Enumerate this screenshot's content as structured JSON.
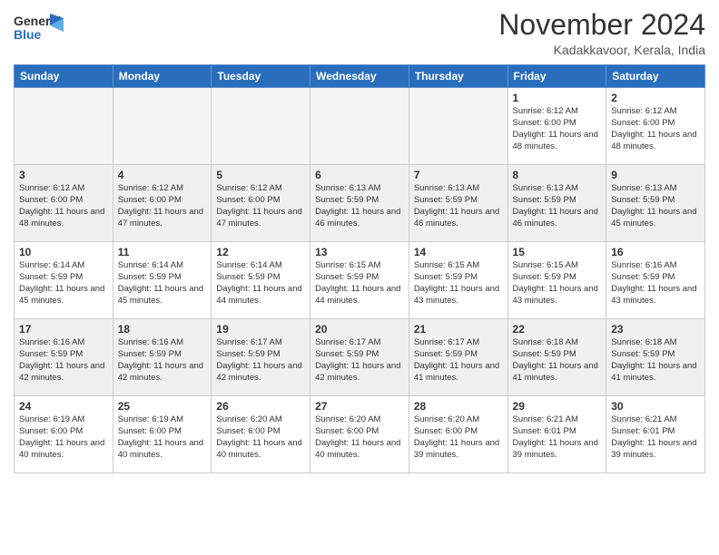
{
  "header": {
    "logo_general": "General",
    "logo_blue": "Blue",
    "month": "November 2024",
    "location": "Kadakkavoor, Kerala, India"
  },
  "days_of_week": [
    "Sunday",
    "Monday",
    "Tuesday",
    "Wednesday",
    "Thursday",
    "Friday",
    "Saturday"
  ],
  "weeks": [
    [
      {
        "day": "",
        "empty": true
      },
      {
        "day": "",
        "empty": true
      },
      {
        "day": "",
        "empty": true
      },
      {
        "day": "",
        "empty": true
      },
      {
        "day": "",
        "empty": true
      },
      {
        "day": "1",
        "sunrise": "6:12 AM",
        "sunset": "6:00 PM",
        "daylight": "11 hours and 48 minutes."
      },
      {
        "day": "2",
        "sunrise": "6:12 AM",
        "sunset": "6:00 PM",
        "daylight": "11 hours and 48 minutes."
      }
    ],
    [
      {
        "day": "3",
        "sunrise": "6:12 AM",
        "sunset": "6:00 PM",
        "daylight": "11 hours and 48 minutes."
      },
      {
        "day": "4",
        "sunrise": "6:12 AM",
        "sunset": "6:00 PM",
        "daylight": "11 hours and 47 minutes."
      },
      {
        "day": "5",
        "sunrise": "6:12 AM",
        "sunset": "6:00 PM",
        "daylight": "11 hours and 47 minutes."
      },
      {
        "day": "6",
        "sunrise": "6:13 AM",
        "sunset": "5:59 PM",
        "daylight": "11 hours and 46 minutes."
      },
      {
        "day": "7",
        "sunrise": "6:13 AM",
        "sunset": "5:59 PM",
        "daylight": "11 hours and 46 minutes."
      },
      {
        "day": "8",
        "sunrise": "6:13 AM",
        "sunset": "5:59 PM",
        "daylight": "11 hours and 46 minutes."
      },
      {
        "day": "9",
        "sunrise": "6:13 AM",
        "sunset": "5:59 PM",
        "daylight": "11 hours and 45 minutes."
      }
    ],
    [
      {
        "day": "10",
        "sunrise": "6:14 AM",
        "sunset": "5:59 PM",
        "daylight": "11 hours and 45 minutes."
      },
      {
        "day": "11",
        "sunrise": "6:14 AM",
        "sunset": "5:59 PM",
        "daylight": "11 hours and 45 minutes."
      },
      {
        "day": "12",
        "sunrise": "6:14 AM",
        "sunset": "5:59 PM",
        "daylight": "11 hours and 44 minutes."
      },
      {
        "day": "13",
        "sunrise": "6:15 AM",
        "sunset": "5:59 PM",
        "daylight": "11 hours and 44 minutes."
      },
      {
        "day": "14",
        "sunrise": "6:15 AM",
        "sunset": "5:59 PM",
        "daylight": "11 hours and 43 minutes."
      },
      {
        "day": "15",
        "sunrise": "6:15 AM",
        "sunset": "5:59 PM",
        "daylight": "11 hours and 43 minutes."
      },
      {
        "day": "16",
        "sunrise": "6:16 AM",
        "sunset": "5:59 PM",
        "daylight": "11 hours and 43 minutes."
      }
    ],
    [
      {
        "day": "17",
        "sunrise": "6:16 AM",
        "sunset": "5:59 PM",
        "daylight": "11 hours and 42 minutes."
      },
      {
        "day": "18",
        "sunrise": "6:16 AM",
        "sunset": "5:59 PM",
        "daylight": "11 hours and 42 minutes."
      },
      {
        "day": "19",
        "sunrise": "6:17 AM",
        "sunset": "5:59 PM",
        "daylight": "11 hours and 42 minutes."
      },
      {
        "day": "20",
        "sunrise": "6:17 AM",
        "sunset": "5:59 PM",
        "daylight": "11 hours and 42 minutes."
      },
      {
        "day": "21",
        "sunrise": "6:17 AM",
        "sunset": "5:59 PM",
        "daylight": "11 hours and 41 minutes."
      },
      {
        "day": "22",
        "sunrise": "6:18 AM",
        "sunset": "5:59 PM",
        "daylight": "11 hours and 41 minutes."
      },
      {
        "day": "23",
        "sunrise": "6:18 AM",
        "sunset": "5:59 PM",
        "daylight": "11 hours and 41 minutes."
      }
    ],
    [
      {
        "day": "24",
        "sunrise": "6:19 AM",
        "sunset": "6:00 PM",
        "daylight": "11 hours and 40 minutes."
      },
      {
        "day": "25",
        "sunrise": "6:19 AM",
        "sunset": "6:00 PM",
        "daylight": "11 hours and 40 minutes."
      },
      {
        "day": "26",
        "sunrise": "6:20 AM",
        "sunset": "6:00 PM",
        "daylight": "11 hours and 40 minutes."
      },
      {
        "day": "27",
        "sunrise": "6:20 AM",
        "sunset": "6:00 PM",
        "daylight": "11 hours and 40 minutes."
      },
      {
        "day": "28",
        "sunrise": "6:20 AM",
        "sunset": "6:00 PM",
        "daylight": "11 hours and 39 minutes."
      },
      {
        "day": "29",
        "sunrise": "6:21 AM",
        "sunset": "6:01 PM",
        "daylight": "11 hours and 39 minutes."
      },
      {
        "day": "30",
        "sunrise": "6:21 AM",
        "sunset": "6:01 PM",
        "daylight": "11 hours and 39 minutes."
      }
    ]
  ]
}
